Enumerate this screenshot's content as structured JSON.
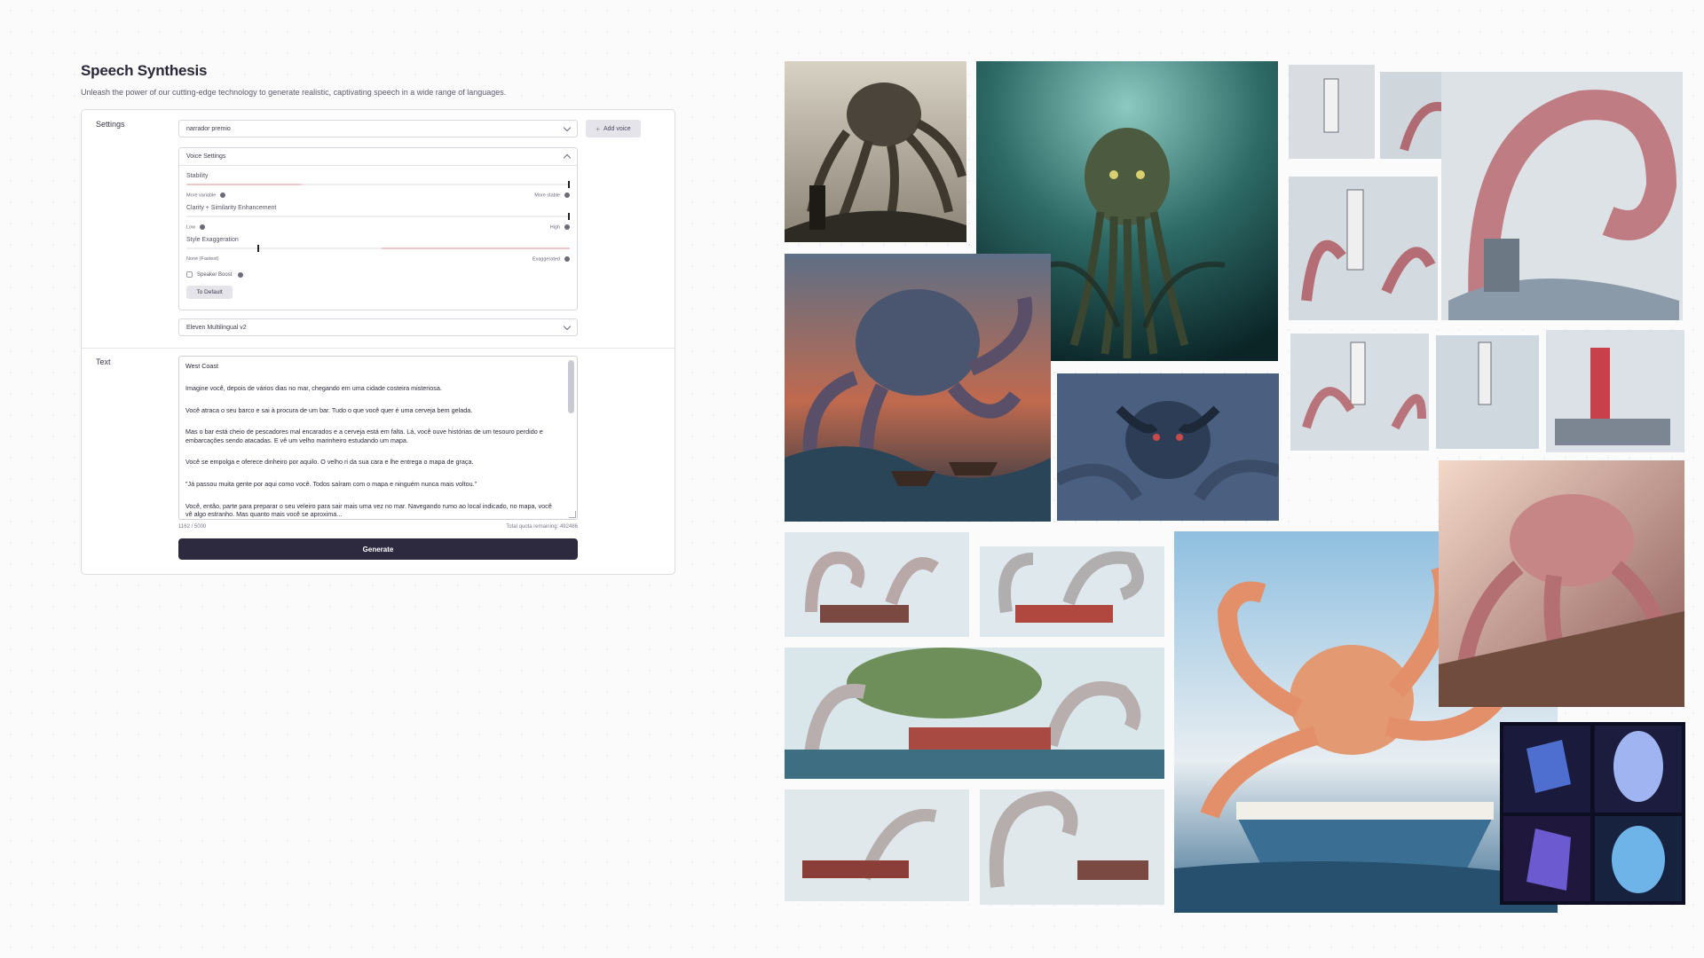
{
  "page": {
    "title": "Speech Synthesis",
    "subtitle": "Unleash the power of our cutting-edge technology to generate realistic, captivating speech in a wide range of languages."
  },
  "settings": {
    "label": "Settings",
    "voice_select": "narrador premio",
    "add_voice": "Add voice",
    "voice_settings": {
      "header": "Voice Settings",
      "stability": {
        "label": "Stability",
        "min_label": "More variable",
        "max_label": "More stable",
        "value": 1.0
      },
      "clarity": {
        "label": "Clarity + Similarity Enhancement",
        "min_label": "Low",
        "max_label": "High",
        "value": 1.0
      },
      "style": {
        "label": "Style Exaggeration",
        "min_label": "None (Fastest)",
        "max_label": "Exaggerated",
        "value": 0.15
      },
      "speaker_boost": {
        "label": "Speaker Boost",
        "checked": false
      },
      "to_default": "To Default"
    },
    "model_select": "Eleven Multilingual v2"
  },
  "text_section": {
    "label": "Text",
    "paragraphs": [
      "West Coast",
      "Imagine você, depois de vários dias no mar, chegando em uma cidade costeira misteriosa.",
      "Você atraca o seu barco e sai à procura de um bar. Tudo o que você quer é uma cerveja bem gelada.",
      "Mas o bar está cheio de pescadores mal encarados e a cerveja está em falta. Lá, você ouve histórias de um tesouro perdido e embarcações sendo atacadas. E vê um velho marinheiro estudando um mapa.",
      "Você se empolga e oferece dinheiro por aquilo. O velho ri da sua cara e lhe entrega o mapa de graça.",
      "\"Já passou muita gente por aqui como você. Todos saíram com o mapa e ninguém nunca mais voltou.\"",
      "Você, então, parte para preparar o seu veleiro para sair mais uma vez no mar. Navegando rumo ao local indicado, no mapa, você vê algo estranho. Mas quanto mais você se aproxima..."
    ],
    "char_count": "1162 / 5000",
    "quota": "Total quota remaining: 492486",
    "generate": "Generate"
  },
  "colors": {
    "accent": "#2d2a40",
    "slider_fill": "#f2c8cc",
    "background": "#fbfbfc"
  },
  "gallery": {
    "images": [
      "vintage-octopus-photo",
      "underwater-cthulhu",
      "lighthouse-kraken-sketches",
      "kraken-storm-ships",
      "blue-kraken-face",
      "anime-octopus-boats",
      "anime-octopus-fishing-boat",
      "octopus-on-ship-deck",
      "blue-glowing-caves"
    ]
  }
}
